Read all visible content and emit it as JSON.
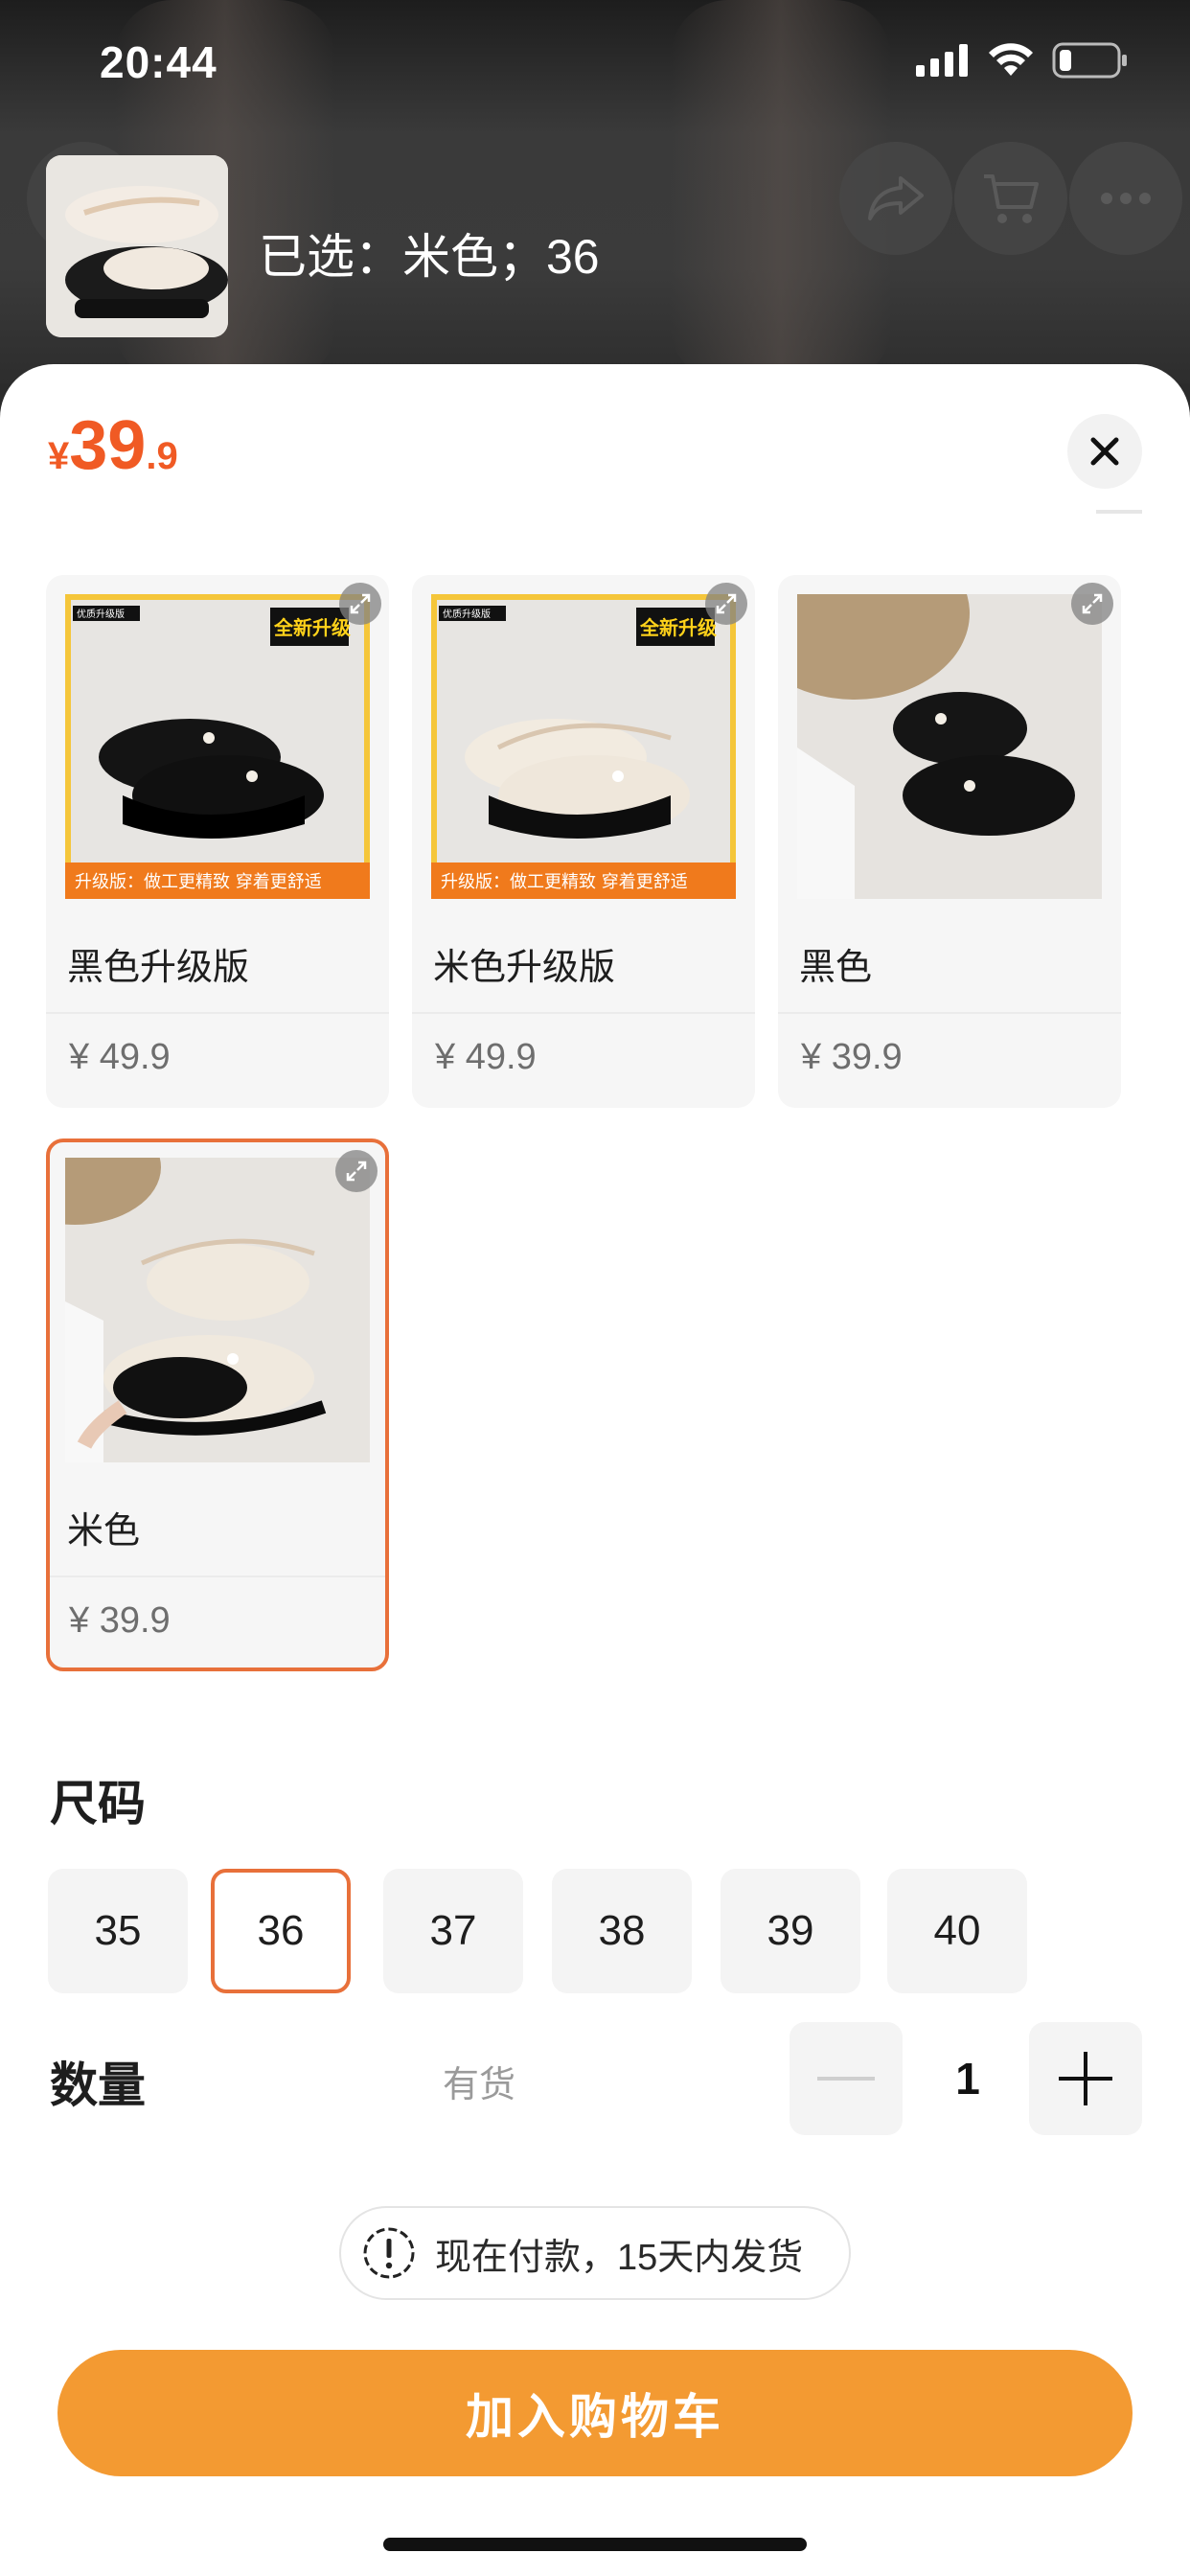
{
  "status_bar": {
    "time": "20:44"
  },
  "header": {
    "summary_text": "已选：米色；36",
    "thumbnail": "shoe-thumbnail-image"
  },
  "header_actions": [
    "share-icon",
    "cart-icon",
    "more-icon"
  ],
  "sheet": {
    "price": {
      "currency": "¥",
      "integer": "39",
      "decimal": ".9"
    },
    "colors": [
      {
        "name": "黑色升级版",
        "price": "¥ 49.9",
        "badge_small": "优质升级版",
        "badge_big": "全新升级",
        "banner": "升级版：做工更精致 穿着更舒适",
        "selected": false
      },
      {
        "name": "米色升级版",
        "price": "¥ 49.9",
        "badge_small": "优质升级版",
        "badge_big": "全新升级",
        "banner": "升级版：做工更精致 穿着更舒适",
        "selected": false
      },
      {
        "name": "黑色",
        "price": "¥ 39.9",
        "selected": false
      },
      {
        "name": "米色",
        "price": "¥ 39.9",
        "selected": true
      }
    ],
    "size": {
      "label": "尺码",
      "options": [
        "35",
        "36",
        "37",
        "38",
        "39",
        "40"
      ],
      "selected": "36"
    },
    "quantity": {
      "label": "数量",
      "stock": "有货",
      "value": "1"
    },
    "notice": "现在付款，15天内发货",
    "add_to_cart": "加入购物车"
  },
  "colors": {
    "accent": "#f05a24",
    "selected_border": "#e8703a",
    "button": "#f39a32"
  }
}
